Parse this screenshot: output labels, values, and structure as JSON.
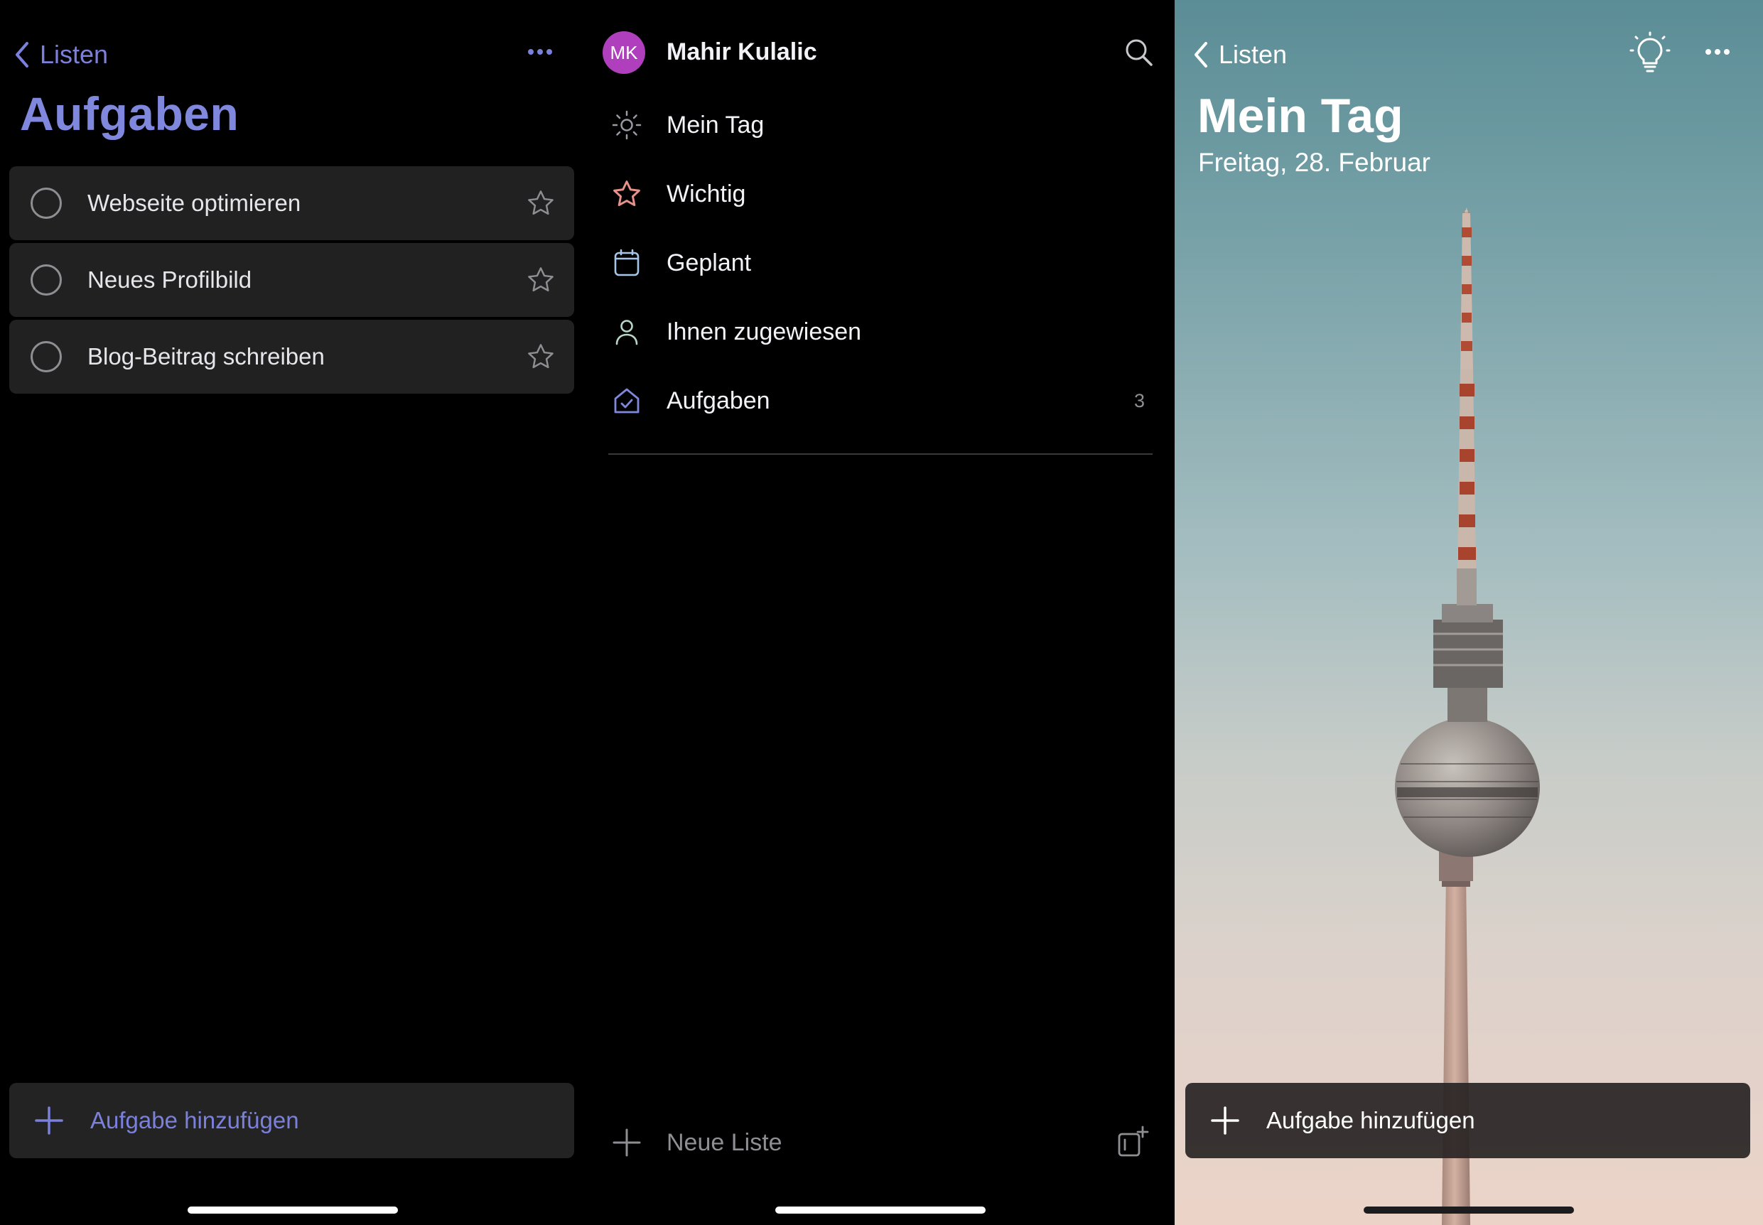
{
  "left": {
    "back_label": "Listen",
    "title": "Aufgaben",
    "tasks": [
      {
        "label": "Webseite optimieren"
      },
      {
        "label": "Neues Profilbild"
      },
      {
        "label": "Blog-Beitrag schreiben"
      }
    ],
    "add_task_label": "Aufgabe hinzufügen"
  },
  "middle": {
    "avatar_initials": "MK",
    "user_name": "Mahir Kulalic",
    "nav": [
      {
        "label": "Mein Tag",
        "icon": "sun-icon"
      },
      {
        "label": "Wichtig",
        "icon": "star-icon"
      },
      {
        "label": "Geplant",
        "icon": "calendar-icon"
      },
      {
        "label": "Ihnen zugewiesen",
        "icon": "person-icon"
      },
      {
        "label": "Aufgaben",
        "icon": "home-check-icon",
        "count": "3"
      }
    ],
    "new_list_label": "Neue Liste"
  },
  "right": {
    "back_label": "Listen",
    "title": "Mein Tag",
    "date": "Freitag, 28. Februar",
    "add_task_label": "Aufgabe hinzufügen"
  },
  "colors": {
    "accent": "#7b80db",
    "avatar": "#b03fbd",
    "task_bg": "#212121",
    "star_nav": "#e8908a",
    "sun_nav": "#9a9aa5"
  }
}
